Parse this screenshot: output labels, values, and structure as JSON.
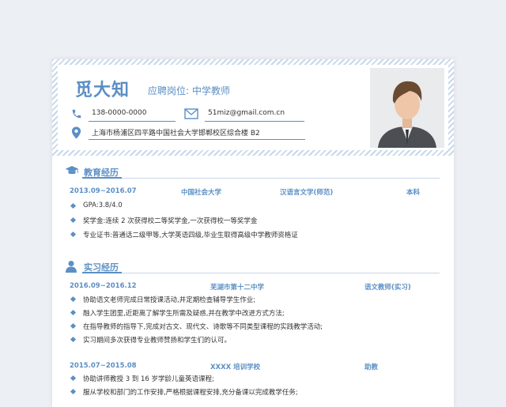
{
  "header": {
    "name": "觅大知",
    "position_label": "应聘岗位:",
    "position_value": "中学教师",
    "phone": "138-0000-0000",
    "email": "51miz@gmail.com.cn",
    "address": "上海市杨浦区四平路中国社会大学邯郸校区综合楼 B2"
  },
  "education": {
    "title": "教育经历",
    "date": "2013.09~2016.07",
    "school": "中国社会大学",
    "major": "汉语言文学(师范)",
    "degree": "本科",
    "bullets": [
      "GPA:3.8/4.0",
      "奖学金:连续 2 次获得校二等奖学金,一次获得校一等奖学金",
      "专业证书:普通话二级甲等,大学英语四级,毕业生取得高级中学教师资格证"
    ]
  },
  "internship": {
    "title": "实习经历",
    "jobs": [
      {
        "date": "2016.09~2016.12",
        "org": "芜湖市第十二中学",
        "role": "语文教师(实习)",
        "bullets": [
          "协助语文老师完成日常授课活动,并定期检查辅导学生作业;",
          "融入学生团里,近距离了解学生所需及疑惑,并在教学中改进方式方法;",
          "在指导教师的指导下,完成对古文、现代文、诗歌等不同类型课程的实践教学活动;",
          "实习期间多次获得专业教师赞扬和学生们的认可。"
        ]
      },
      {
        "date": "2015.07~2015.08",
        "org": "XXXX 培训学校",
        "role": "助教",
        "bullets": [
          "协助讲师教授 3 到 16 岁学龄儿童英语课程;",
          "服从学校和部门的工作安排,严格根据课程安排,充分备课以完成教学任务;"
        ]
      }
    ]
  },
  "colors": {
    "accent": "#5b8fc5",
    "text": "#333333"
  },
  "icons": [
    "phone-icon",
    "email-icon",
    "location-icon",
    "graduation-cap-icon",
    "person-icon"
  ]
}
